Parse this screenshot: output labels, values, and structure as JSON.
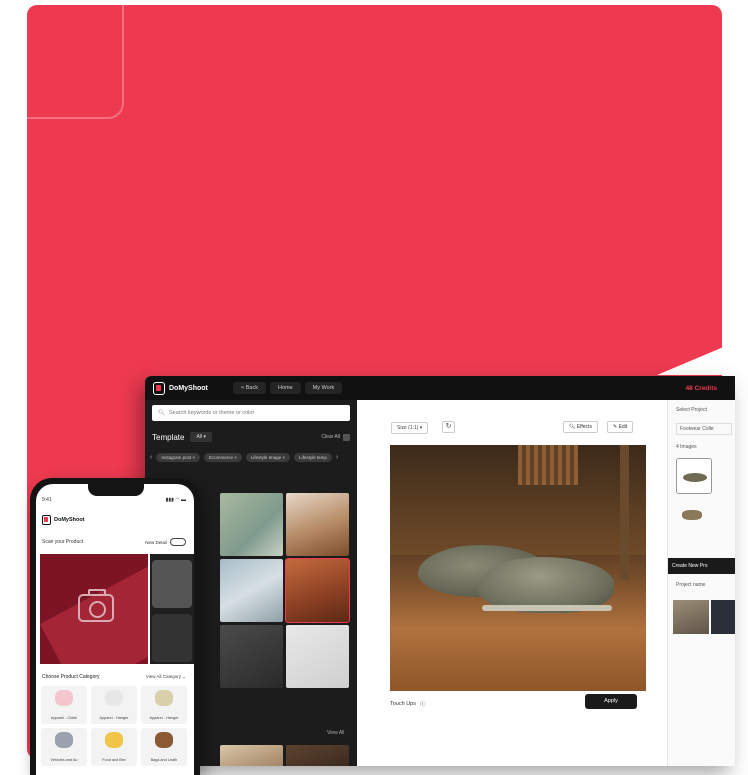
{
  "colors": {
    "brand": "#ee3a50",
    "dark": "#111111"
  },
  "desktop": {
    "app_name": "DoMyShoot",
    "nav": [
      "< Back",
      "Home",
      "My Work"
    ],
    "credits": "48 Credits",
    "search_placeholder": "Search keywords or theme or color",
    "template_title": "Template",
    "template_filter": "All",
    "clear_all": "Clear All",
    "chips": [
      "Instagram post",
      "Ecommerce",
      "Lifestyle Image",
      "Lifestyle temp"
    ],
    "view_all": "View All",
    "size_dropdown": "Size (1:1)",
    "effects_label": "Effects",
    "edit_label": "Edit",
    "touch_label": "Touch Ups",
    "apply_label": "Apply",
    "right_panel": {
      "select_project": "Select Project",
      "project_value": "Footwear Colle",
      "images_label": "4 Images",
      "create_new": "Create New Pro",
      "project_name": "Project name"
    }
  },
  "phone": {
    "time": "9:41",
    "status_icons": "▮▮▮ ◠ ▬",
    "app_name": "DoMyShoot",
    "scan_label": "Scan your Product",
    "new_detail": "New Detail",
    "category_title": "Choose Product Category",
    "category_filter": "View All Category ⌄",
    "categories": [
      {
        "label": "Apparel - Clothi",
        "color": "#f3c6cc"
      },
      {
        "label": "Apparel - Hanger",
        "color": "#e7e7e7"
      },
      {
        "label": "Apparel - Hanger",
        "color": "#d9cfa8"
      },
      {
        "label": "Vehicles and Au",
        "color": "#9aa3ad"
      },
      {
        "label": "Food and Bev",
        "color": "#f0c64a"
      },
      {
        "label": "Bags and Leath",
        "color": "#8b5a35"
      }
    ]
  }
}
